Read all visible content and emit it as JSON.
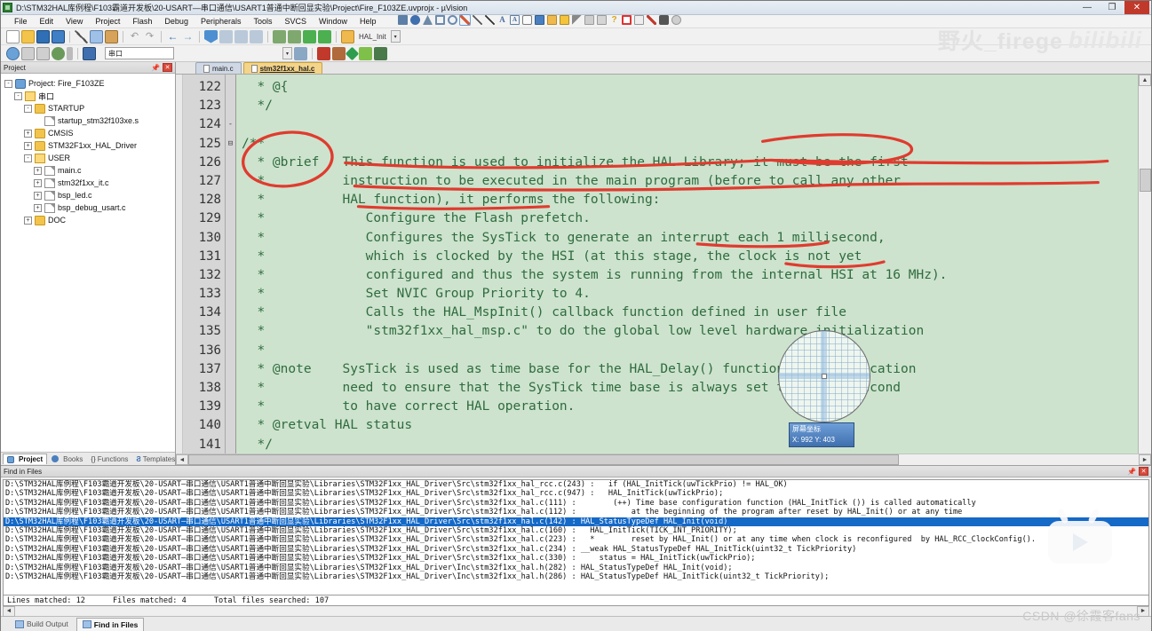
{
  "window": {
    "title": "D:\\STM32HAL库例程\\F103霸道开发板\\20-USART—串口通信\\USART1普通中断回显实验\\Project\\Fire_F103ZE.uvprojx - µVision",
    "app_icon": "uvision-icon",
    "minimize": "—",
    "maximize": "❐",
    "close": "✕"
  },
  "menu": [
    "File",
    "Edit",
    "View",
    "Project",
    "Flash",
    "Debug",
    "Peripherals",
    "Tools",
    "SVCS",
    "Window",
    "Help"
  ],
  "toolbar": {
    "target_combo": "",
    "hal_init_label": "HAL_Init",
    "second_row_combo": "串口"
  },
  "watermarks": {
    "bilibili": "野火_firege",
    "bilibili_logo": "bilibili",
    "csdn": "CSDN @徐霞客fans"
  },
  "project_panel": {
    "header": "Project",
    "pin_icon": "pin-icon",
    "close_icon": "close-icon",
    "tree": [
      {
        "label": "Project: Fire_F103ZE",
        "indent": 0,
        "icon": "project-icon",
        "expander": "-"
      },
      {
        "label": "串口",
        "indent": 1,
        "icon": "folder-open-icon",
        "expander": "-"
      },
      {
        "label": "STARTUP",
        "indent": 2,
        "icon": "folder-icon",
        "expander": "-"
      },
      {
        "label": "startup_stm32f103xe.s",
        "indent": 3,
        "icon": "file-icon",
        "expander": ""
      },
      {
        "label": "CMSIS",
        "indent": 2,
        "icon": "folder-icon",
        "expander": "+"
      },
      {
        "label": "STM32F1xx_HAL_Driver",
        "indent": 2,
        "icon": "folder-icon",
        "expander": "+"
      },
      {
        "label": "USER",
        "indent": 2,
        "icon": "folder-open-icon",
        "expander": "-"
      },
      {
        "label": "main.c",
        "indent": 3,
        "icon": "file-icon",
        "expander": "+"
      },
      {
        "label": "stm32f1xx_it.c",
        "indent": 3,
        "icon": "file-icon",
        "expander": "+"
      },
      {
        "label": "bsp_led.c",
        "indent": 3,
        "icon": "file-icon",
        "expander": "+"
      },
      {
        "label": "bsp_debug_usart.c",
        "indent": 3,
        "icon": "file-icon",
        "expander": "+"
      },
      {
        "label": "DOC",
        "indent": 2,
        "icon": "folder-icon",
        "expander": "+"
      }
    ],
    "tabs": [
      {
        "label": "Project",
        "icon": "project-icon",
        "active": true
      },
      {
        "label": "Books",
        "icon": "books-icon",
        "active": false
      },
      {
        "label": "Functions",
        "icon": "braces-icon",
        "active": false
      },
      {
        "label": "Templates",
        "icon": "template-icon",
        "active": false
      }
    ]
  },
  "editor": {
    "tabs": [
      {
        "label": "main.c",
        "active": false
      },
      {
        "label": "stm32f1xx_hal.c",
        "active": true
      }
    ],
    "first_line": 122,
    "lines": [
      {
        "n": 122,
        "fold": "",
        "text": "  * @{"
      },
      {
        "n": 123,
        "fold": "",
        "text": "  */"
      },
      {
        "n": 124,
        "fold": "-",
        "text": ""
      },
      {
        "n": 125,
        "fold": "⊟",
        "text": "/**"
      },
      {
        "n": 126,
        "fold": "",
        "text": "  * @brief   This function is used to initialize the HAL Library; it must be the first"
      },
      {
        "n": 127,
        "fold": "",
        "text": "  *          instruction to be executed in the main program (before to call any other"
      },
      {
        "n": 128,
        "fold": "",
        "text": "  *          HAL function), it performs the following:"
      },
      {
        "n": 129,
        "fold": "",
        "text": "  *             Configure the Flash prefetch."
      },
      {
        "n": 130,
        "fold": "",
        "text": "  *             Configures the SysTick to generate an interrupt each 1 millisecond,"
      },
      {
        "n": 131,
        "fold": "",
        "text": "  *             which is clocked by the HSI (at this stage, the clock is not yet"
      },
      {
        "n": 132,
        "fold": "",
        "text": "  *             configured and thus the system is running from the internal HSI at 16 MHz)."
      },
      {
        "n": 133,
        "fold": "",
        "text": "  *             Set NVIC Group Priority to 4."
      },
      {
        "n": 134,
        "fold": "",
        "text": "  *             Calls the HAL_MspInit() callback function defined in user file"
      },
      {
        "n": 135,
        "fold": "",
        "text": "  *             \"stm32f1xx_hal_msp.c\" to do the global low level hardware initialization"
      },
      {
        "n": 136,
        "fold": "",
        "text": "  *"
      },
      {
        "n": 137,
        "fold": "",
        "text": "  * @note    SysTick is used as time base for the HAL_Delay() function, the application"
      },
      {
        "n": 138,
        "fold": "",
        "text": "  *          need to ensure that the SysTick time base is always set to 1 millisecond"
      },
      {
        "n": 139,
        "fold": "",
        "text": "  *          to have correct HAL operation."
      },
      {
        "n": 140,
        "fold": "",
        "text": "  * @retval HAL status"
      },
      {
        "n": 141,
        "fold": "",
        "text": "  */"
      }
    ],
    "colors": {
      "bg": "#cde3cd",
      "text": "#2f6b3f",
      "gutter_bg": "#d6d6d6",
      "ink": "#e03b2f"
    }
  },
  "magnifier": {
    "tooltip_title": "屏幕坐标",
    "tooltip_coords": "X: 992 Y: 403"
  },
  "find_in_files": {
    "header": "Find in Files",
    "pin_icon": "pin-icon",
    "close_icon": "close-icon",
    "selected_index": 4,
    "rows": [
      "D:\\STM32HAL库例程\\F103霸道开发板\\20-USART—串口通信\\USART1普通中断回显实验\\Libraries\\STM32F1xx_HAL_Driver\\Src\\stm32f1xx_hal_rcc.c(243) :   if (HAL_InitTick(uwTickPrio) != HAL_OK)",
      "D:\\STM32HAL库例程\\F103霸道开发板\\20-USART—串口通信\\USART1普通中断回显实验\\Libraries\\STM32F1xx_HAL_Driver\\Src\\stm32f1xx_hal_rcc.c(947) :   HAL_InitTick(uwTickPrio);",
      "D:\\STM32HAL库例程\\F103霸道开发板\\20-USART—串口通信\\USART1普通中断回显实验\\Libraries\\STM32F1xx_HAL_Driver\\Src\\stm32f1xx_hal.c(111) :        (++) Time base configuration function (HAL_InitTick ()) is called automatically",
      "D:\\STM32HAL库例程\\F103霸道开发板\\20-USART—串口通信\\USART1普通中断回显实验\\Libraries\\STM32F1xx_HAL_Driver\\Src\\stm32f1xx_hal.c(112) :            at the beginning of the program after reset by HAL_Init() or at any time",
      "D:\\STM32HAL库例程\\F103霸道开发板\\20-USART—串口通信\\USART1普通中断回显实验\\Libraries\\STM32F1xx_HAL_Driver\\Src\\stm32f1xx_hal.c(142) : HAL_StatusTypeDef HAL_Init(void)",
      "D:\\STM32HAL库例程\\F103霸道开发板\\20-USART—串口通信\\USART1普通中断回显实验\\Libraries\\STM32F1xx_HAL_Driver\\Src\\stm32f1xx_hal.c(160) :   HAL_InitTick(TICK_INT_PRIORITY);",
      "D:\\STM32HAL库例程\\F103霸道开发板\\20-USART—串口通信\\USART1普通中断回显实验\\Libraries\\STM32F1xx_HAL_Driver\\Src\\stm32f1xx_hal.c(223) :   *        reset by HAL_Init() or at any time when clock is reconfigured  by HAL_RCC_ClockConfig().",
      "D:\\STM32HAL库例程\\F103霸道开发板\\20-USART—串口通信\\USART1普通中断回显实验\\Libraries\\STM32F1xx_HAL_Driver\\Src\\stm32f1xx_hal.c(234) : __weak HAL_StatusTypeDef HAL_InitTick(uint32_t TickPriority)",
      "D:\\STM32HAL库例程\\F103霸道开发板\\20-USART—串口通信\\USART1普通中断回显实验\\Libraries\\STM32F1xx_HAL_Driver\\Src\\stm32f1xx_hal.c(330) :     status = HAL_InitTick(uwTickPrio);",
      "D:\\STM32HAL库例程\\F103霸道开发板\\20-USART—串口通信\\USART1普通中断回显实验\\Libraries\\STM32F1xx_HAL_Driver\\Inc\\stm32f1xx_hal.h(282) : HAL_StatusTypeDef HAL_Init(void);",
      "D:\\STM32HAL库例程\\F103霸道开发板\\20-USART—串口通信\\USART1普通中断回显实验\\Libraries\\STM32F1xx_HAL_Driver\\Inc\\stm32f1xx_hal.h(286) : HAL_StatusTypeDef HAL_InitTick(uint32_t TickPriority);"
    ],
    "summary": "Lines matched: 12      Files matched: 4      Total files searched: 107"
  },
  "bottom_tabs": [
    {
      "label": "Build Output",
      "icon": "build-output-icon",
      "active": false
    },
    {
      "label": "Find in Files",
      "icon": "find-in-files-icon",
      "active": true
    }
  ]
}
